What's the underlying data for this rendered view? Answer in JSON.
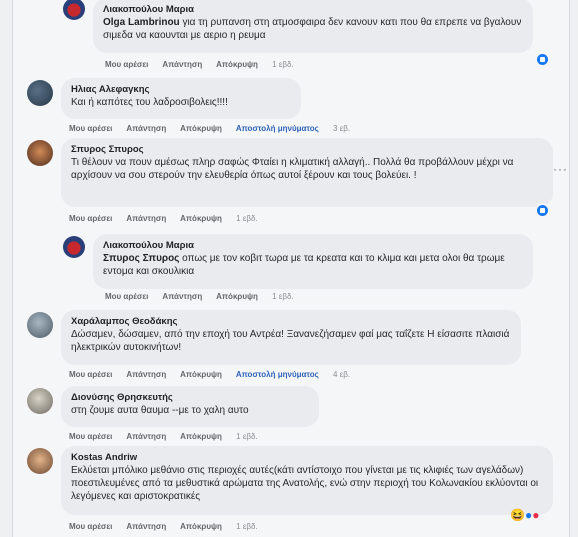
{
  "actions": {
    "like": "Μου αρέσει",
    "reply": "Απάντηση",
    "translate": "Απόκρυψη",
    "send_message": "Αποστολή μηνύματος"
  },
  "comments": [
    {
      "author": "Λιακοπούλου Μαρια",
      "mention": "Olga Lambrinou",
      "text": "για τη ρυπανση στη ατμοσφαιρα δεν κανουν κατι που θα επρεπε να βγαλουν σιμεδα να καουνται με αεριο η ρευμα",
      "time": "1 εβδ."
    },
    {
      "author": "Ηλιας Αλεφαγκης",
      "mention": "",
      "text": "Και ή καπότες του λαδροσιβολεις!!!!",
      "time": "3 εβ."
    },
    {
      "author": "Σπυρος Σπυρος",
      "mention": "",
      "text": "Τι θέλουν να πουν αμέσως πληρ σαφώς Φταίει η κλιματική αλλαγή.. Πολλά θα προβάλλουν μέχρι να αρχίσουν να σου στερούν την ελευθερία όπως αυτοί ξέρουν και τους βολεύει. !",
      "time": "1 εβδ."
    },
    {
      "author": "Λιακοπούλου Μαρια",
      "mention": "Σπυρος Σπυρος",
      "text": "οπως με τον κοβιτ τωρα με τα κρεατα και το κλιμα και μετα ολοι θα τρωμε εντομα και σκουλικια",
      "time": "1 εβδ."
    },
    {
      "author": "Χαράλαμπος Θεοδάκης",
      "mention": "",
      "text": "Δώσαμεν, δώσαμεν, από την εποχή του Αντρέα! Ξανανεζήσαμεν φαί μας ταΐζετε Η είσασιτε πλαισιά ηλεκτρικών αυτοκινήτων!",
      "time": "4 εβ."
    },
    {
      "author": "Διονύσης Θρησκευτής",
      "mention": "",
      "text": "στη ζουμε αυτα θαυμα --με το χαλη αυτο",
      "time": "1 εβδ."
    },
    {
      "author": "Kostas Andriw",
      "mention": "",
      "text": "Εκλύεται μπόλικο μεθάνιο στις περιοχές αυτές(κάτι αντίστοιχο που γίνεται με τις κλιφιές των αγελάδων) ποεστιλευμένες από τα μεθυστικά αρώματα της Ανατολής, ενώ στην περιοχή του Κολωνακίου εκλύονται οι λεγόμενες και αριστοκρατικές",
      "time": "1 εβδ."
    }
  ]
}
